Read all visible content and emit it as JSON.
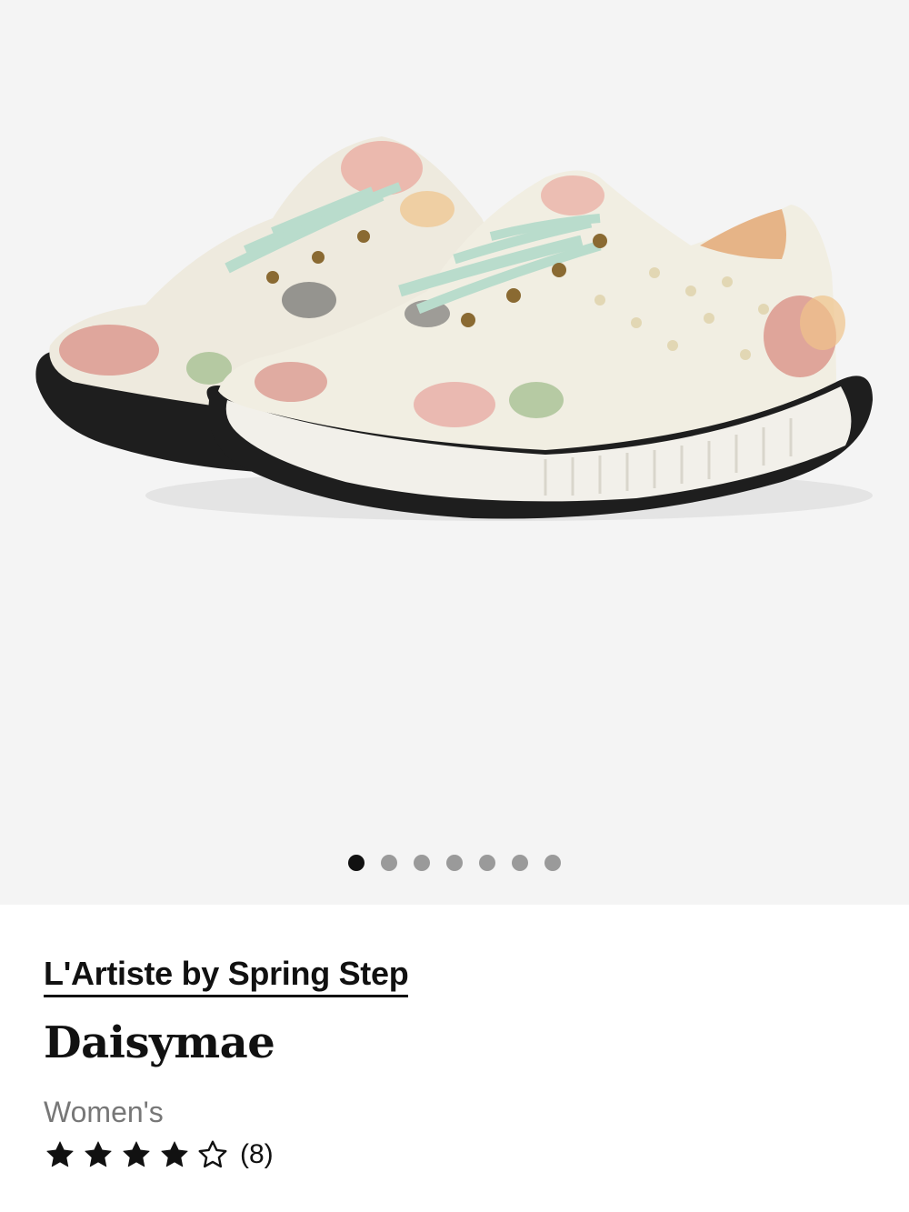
{
  "product": {
    "brand": "L'Artiste by Spring Step",
    "name": "Daisymae",
    "gender": "Women's",
    "rating": 4,
    "rating_max": 5,
    "review_count_label": "(8)"
  },
  "gallery": {
    "image_count": 7,
    "active_index": 0,
    "image_description": "floral-sneakers-product-photo"
  },
  "colors": {
    "gallery_background": "#f4f4f4",
    "active_dot": "#111111",
    "inactive_dot": "#9a9a9a",
    "text_primary": "#111111",
    "text_secondary": "#777777"
  }
}
